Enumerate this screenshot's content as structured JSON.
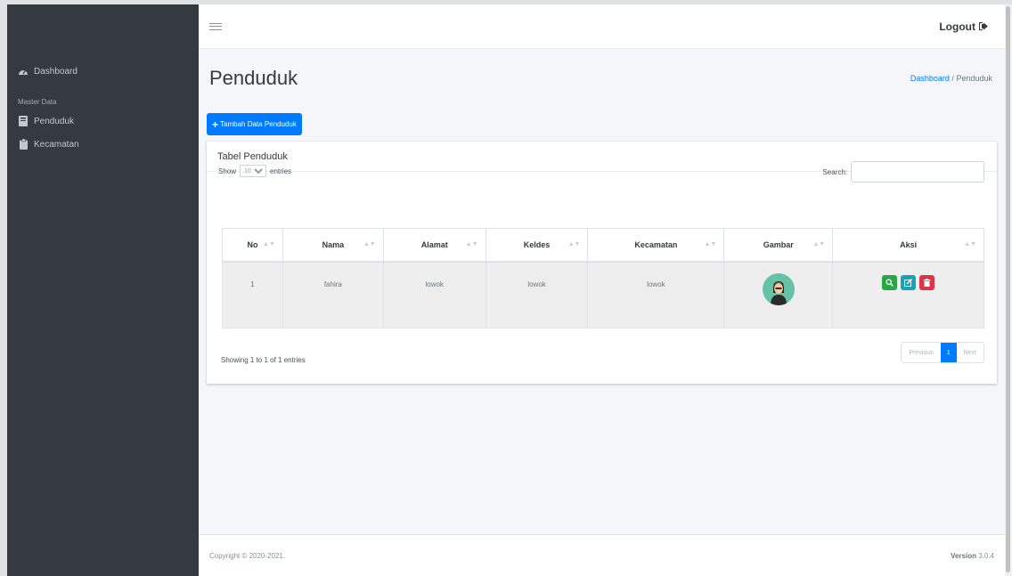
{
  "sidebar": {
    "items": [
      {
        "label": "Dashboard",
        "icon": "tachometer-icon"
      },
      {
        "label": "Penduduk",
        "icon": "book-icon"
      },
      {
        "label": "Kecamatan",
        "icon": "clipboard-icon"
      }
    ],
    "header": "Master Data"
  },
  "topbar": {
    "logout_label": "Logout"
  },
  "page": {
    "title": "Penduduk",
    "breadcrumb": {
      "home": "Dashboard",
      "separator": "/",
      "current": "Penduduk"
    },
    "add_button": "Tambah Data Penduduk"
  },
  "card": {
    "title": "Tabel Penduduk",
    "show_label": "Show",
    "show_value": "10",
    "entries_label": "entries",
    "search_label": "Search:",
    "search_value": ""
  },
  "table": {
    "columns": [
      "No",
      "Nama",
      "Alamat",
      "Keldes",
      "Kecamatan",
      "Gambar",
      "Aksi"
    ],
    "rows": [
      {
        "no": "1",
        "nama": "fahira",
        "alamat": "lowok",
        "keldes": "lowok",
        "kecamatan": "lowok"
      }
    ]
  },
  "pagination": {
    "info": "Showing 1 to 1 of 1 entries",
    "previous": "Previous",
    "page": "1",
    "next": "Next"
  },
  "footer": {
    "copyright": "Copyright © 2020-2021.",
    "version_label": "Version",
    "version_value": "3.0.4"
  },
  "colors": {
    "primary": "#007bff",
    "success": "#28a745",
    "info": "#17a2b8",
    "danger": "#dc3545",
    "sidebar": "#343a40"
  }
}
